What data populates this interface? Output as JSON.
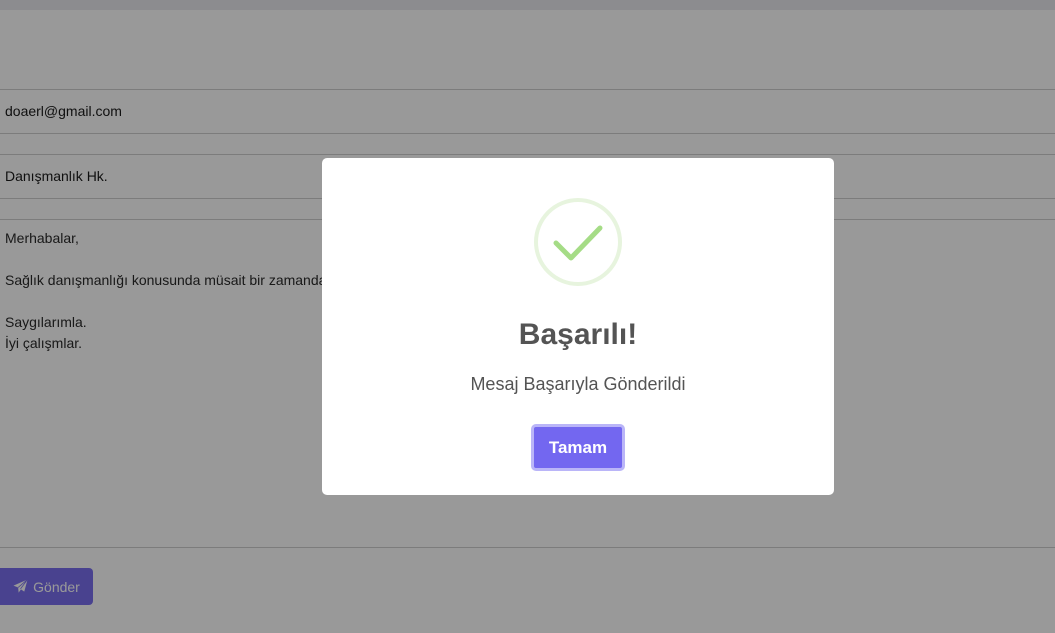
{
  "form": {
    "email_value": "doaerl@gmail.com",
    "subject_value": "Danışmanlık Hk.",
    "message_lines": [
      "Merhabalar,",
      "",
      "Sağlık danışmanlığı konusunda müsait bir zamanda",
      "",
      "Saygılarımla.",
      "İyi çalışmlar."
    ],
    "send_label": "Gönder",
    "send_icon": "paper-plane-icon"
  },
  "modal": {
    "icon": "success-check-icon",
    "title": "Başarılı!",
    "text": "Mesaj Başarıyla Gönderildi",
    "confirm_label": "Tamam"
  },
  "colors": {
    "accent": "#7367f0",
    "success": "#a5dc86",
    "overlay": "rgba(0,0,0,0.4)"
  }
}
